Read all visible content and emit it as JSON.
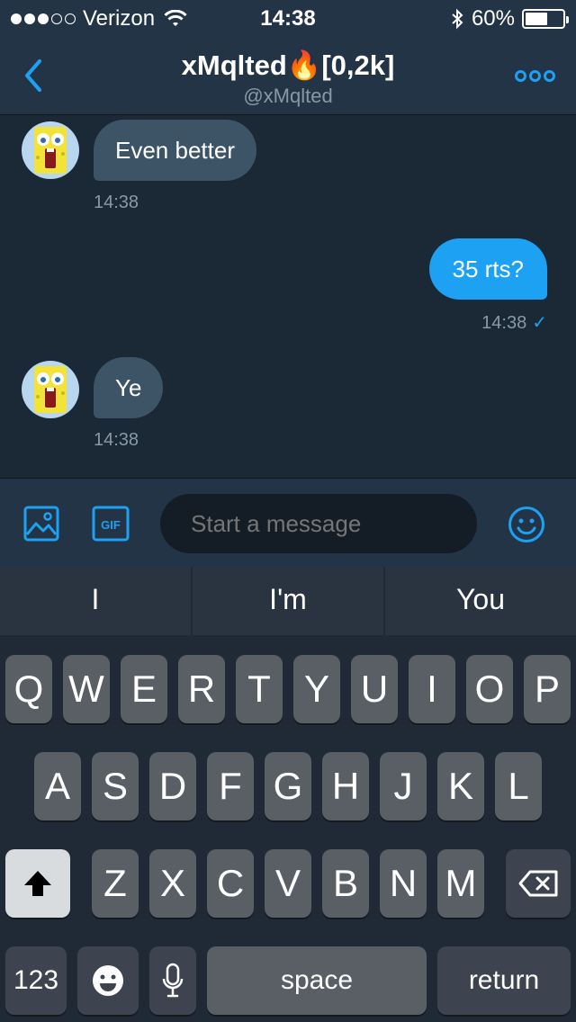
{
  "status": {
    "carrier": "Verizon",
    "time": "14:38",
    "battery": "60%",
    "battery_level": 0.6
  },
  "header": {
    "title": "xMqlted🔥[0,2k]",
    "handle": "@xMqlted"
  },
  "messages": [
    {
      "direction": "in",
      "text": "Even better",
      "time": "14:38"
    },
    {
      "direction": "out",
      "text": "35 rts?",
      "time": "14:38",
      "read_mark": "✓"
    },
    {
      "direction": "in",
      "text": "Ye",
      "time": "14:38"
    }
  ],
  "composer": {
    "placeholder": "Start a message",
    "gif_label": "GIF"
  },
  "keyboard": {
    "suggestions": [
      "I",
      "I'm",
      "You"
    ],
    "row1": [
      "Q",
      "W",
      "E",
      "R",
      "T",
      "Y",
      "U",
      "I",
      "O",
      "P"
    ],
    "row2": [
      "A",
      "S",
      "D",
      "F",
      "G",
      "H",
      "J",
      "K",
      "L"
    ],
    "row3": [
      "Z",
      "X",
      "C",
      "V",
      "B",
      "N",
      "M"
    ],
    "numbers_label": "123",
    "space_label": "space",
    "return_label": "return"
  },
  "colors": {
    "accent": "#1da1f2",
    "background": "#1b2836",
    "bubble_in": "#3d5466"
  }
}
